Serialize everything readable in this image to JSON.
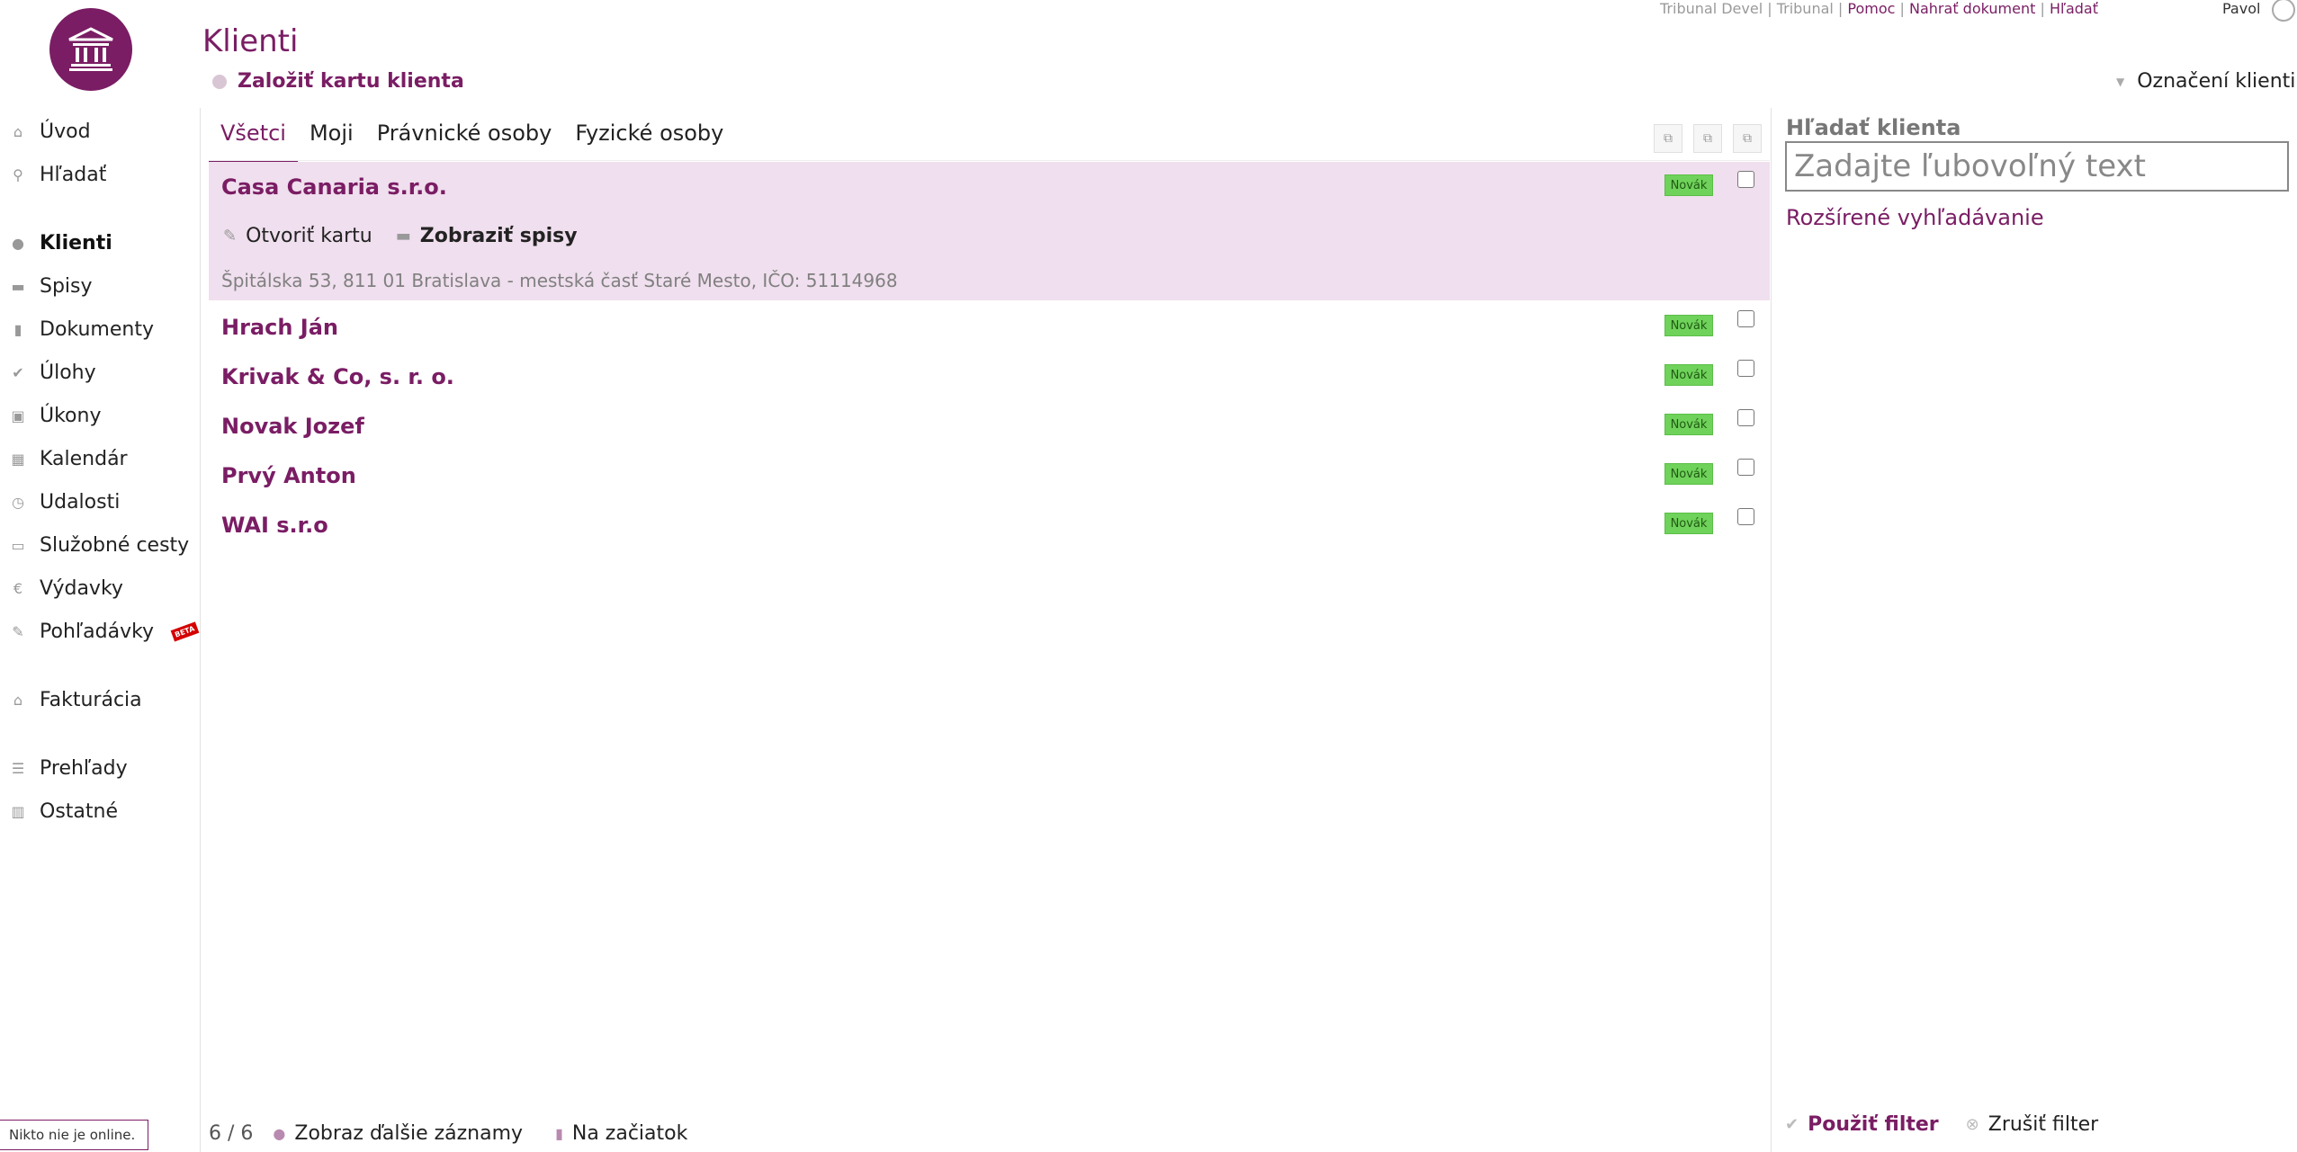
{
  "header": {
    "title": "Klienti",
    "create_label": "Založiť kartu klienta",
    "marked_clients_label": "Označení klienti",
    "user_name": "Pavol"
  },
  "topnav": {
    "env": "Tribunal Devel",
    "app": "Tribunal",
    "help": "Pomoc",
    "upload": "Nahrať dokument",
    "search": "Hľadať"
  },
  "sidebar": {
    "items": [
      {
        "label": "Úvod",
        "icon": "home-icon"
      },
      {
        "label": "Hľadať",
        "icon": "search-icon"
      },
      {
        "label": "Klienti",
        "icon": "user-icon"
      },
      {
        "label": "Spisy",
        "icon": "folder-icon"
      },
      {
        "label": "Dokumenty",
        "icon": "document-icon"
      },
      {
        "label": "Úlohy",
        "icon": "check-icon"
      },
      {
        "label": "Úkony",
        "icon": "briefcase-icon"
      },
      {
        "label": "Kalendár",
        "icon": "calendar-icon"
      },
      {
        "label": "Udalosti",
        "icon": "clock-icon"
      },
      {
        "label": "Služobné cesty",
        "icon": "car-icon"
      },
      {
        "label": "Výdavky",
        "icon": "euro-icon"
      },
      {
        "label": "Pohľadávky",
        "icon": "brush-icon"
      },
      {
        "label": "Fakturácia",
        "icon": "house-icon"
      },
      {
        "label": "Prehľady",
        "icon": "list-icon"
      },
      {
        "label": "Ostatné",
        "icon": "calculator-icon"
      }
    ],
    "beta_label": "BETA",
    "online_status": "Nikto nie je online."
  },
  "tabs": [
    {
      "label": "Všetci"
    },
    {
      "label": "Moji"
    },
    {
      "label": "Právnické osoby"
    },
    {
      "label": "Fyzické osoby"
    }
  ],
  "clients": [
    {
      "name": "Casa Canaria s.r.o.",
      "badge": "Novák",
      "address": "Špitálska 53, 811 01 Bratislava - mestská časť Staré Mesto, IČO: 51114968"
    },
    {
      "name": "Hrach Ján",
      "badge": "Novák"
    },
    {
      "name": "Krivak & Co, s. r. o.",
      "badge": "Novák"
    },
    {
      "name": "Novak Jozef",
      "badge": "Novák"
    },
    {
      "name": "Prvý Anton",
      "badge": "Novák"
    },
    {
      "name": "WAI s.r.o",
      "badge": "Novák"
    }
  ],
  "row_actions": {
    "open_card": "Otvoriť kartu",
    "show_files": "Zobraziť spisy"
  },
  "pager": {
    "count": "6 / 6",
    "more": "Zobraz ďalšie záznamy",
    "to_top": "Na začiatok"
  },
  "search": {
    "label": "Hľadať klienta",
    "placeholder": "Zadajte ľubovoľný text",
    "advanced": "Rozšírené vyhľadávanie",
    "apply": "Použiť filter",
    "cancel": "Zrušiť filter"
  },
  "colors": {
    "brand": "#7a1d64",
    "selected_row": "#f0dfee",
    "badge": "#6fd25a"
  }
}
